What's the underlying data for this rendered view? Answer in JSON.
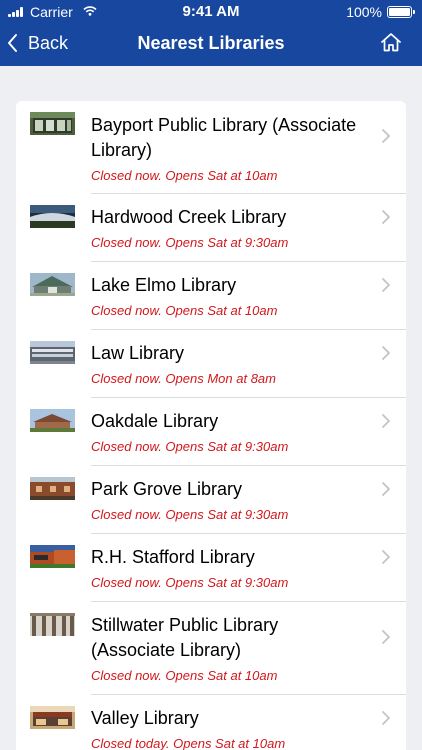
{
  "status_bar": {
    "carrier": "Carrier",
    "time": "9:41 AM",
    "battery": "100%"
  },
  "nav": {
    "back_label": "Back",
    "title": "Nearest Libraries"
  },
  "libraries": [
    {
      "name": "Bayport Public Library (Associate Library)",
      "hours": "Closed now. Opens Sat at 10am"
    },
    {
      "name": "Hardwood Creek Library",
      "hours": "Closed now. Opens Sat at 9:30am"
    },
    {
      "name": "Lake Elmo Library",
      "hours": "Closed now. Opens Sat at 10am"
    },
    {
      "name": "Law Library",
      "hours": "Closed now. Opens Mon at 8am"
    },
    {
      "name": "Oakdale Library",
      "hours": "Closed now. Opens Sat at 9:30am"
    },
    {
      "name": "Park Grove Library",
      "hours": "Closed now. Opens Sat at 9:30am"
    },
    {
      "name": "R.H. Stafford Library",
      "hours": "Closed now. Opens Sat at 9:30am"
    },
    {
      "name": "Stillwater Public Library (Associate Library)",
      "hours": "Closed now. Opens Sat at 10am"
    },
    {
      "name": "Valley Library",
      "hours": "Closed today. Opens Sat at 10am"
    }
  ],
  "colors": {
    "header": "#17479e",
    "background": "#eeeff3",
    "hours_text": "#d1181c"
  }
}
